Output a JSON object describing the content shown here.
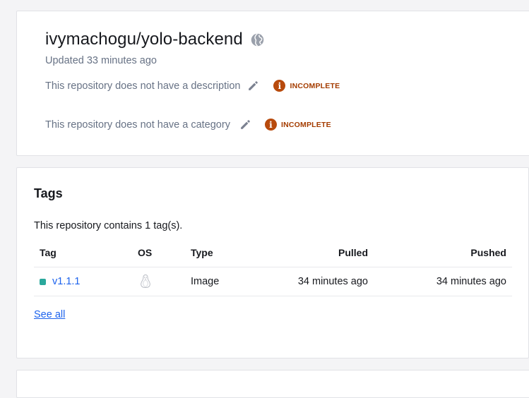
{
  "repo": {
    "title": "ivymachogu/yolo-backend",
    "updated": "Updated 33 minutes ago",
    "description_text": "This repository does not have a description",
    "description_status": "INCOMPLETE",
    "category_text": "This repository does not have a category",
    "category_status": "INCOMPLETE"
  },
  "tags": {
    "title": "Tags",
    "count_text": "This repository contains 1 tag(s).",
    "columns": [
      "Tag",
      "OS",
      "Type",
      "Pulled",
      "Pushed"
    ],
    "rows": [
      {
        "tag": "v1.1.1",
        "os_icon": "linux-icon",
        "type": "Image",
        "pulled": "34 minutes ago",
        "pushed": "34 minutes ago"
      }
    ],
    "see_all": "See all"
  },
  "colors": {
    "link": "#1d63ed",
    "incomplete": "#a43c00",
    "tag_dot": "#2aa89c"
  },
  "icons": {
    "visibility": "globe-icon",
    "edit": "pencil-icon",
    "status": "info-icon"
  }
}
